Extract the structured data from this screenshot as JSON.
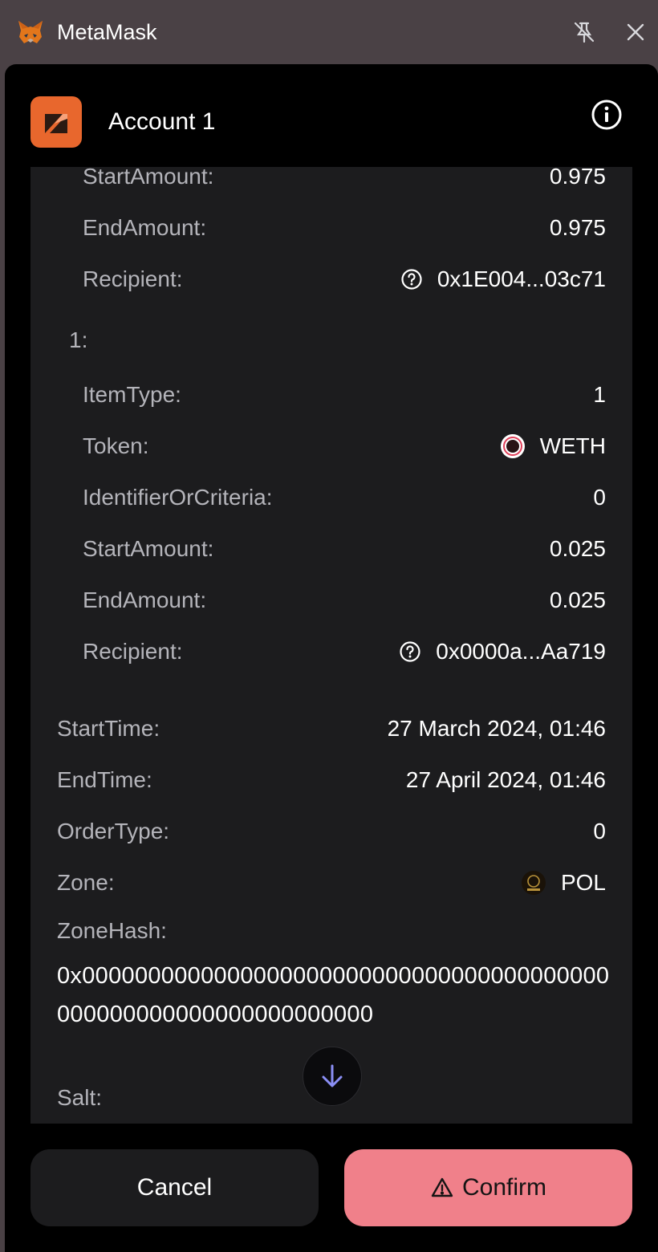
{
  "window": {
    "title": "MetaMask",
    "logo_icon": "metamask-fox-icon",
    "pin_icon": "unpin-icon",
    "close_icon": "close-icon"
  },
  "header": {
    "account_name": "Account 1",
    "avatar_icon": "account-avatar-icon",
    "avatar_color": "#e8672d",
    "info_icon": "info-icon"
  },
  "consideration": {
    "item0_partial": {
      "start_amount_label": "StartAmount:",
      "start_amount": "0.975",
      "end_amount_label": "EndAmount:",
      "end_amount": "0.975",
      "recipient_label": "Recipient:",
      "recipient": "0x1E004...03c71"
    },
    "item1": {
      "index": "1:",
      "item_type_label": "ItemType:",
      "item_type": "1",
      "token_label": "Token:",
      "token": "WETH",
      "identifier_label": "IdentifierOrCriteria:",
      "identifier": "0",
      "start_amount_label": "StartAmount:",
      "start_amount": "0.025",
      "end_amount_label": "EndAmount:",
      "end_amount": "0.025",
      "recipient_label": "Recipient:",
      "recipient": "0x0000a...Aa719"
    }
  },
  "order": {
    "start_time_label": "StartTime:",
    "start_time": "27 March 2024, 01:46",
    "end_time_label": "EndTime:",
    "end_time": "27 April 2024, 01:46",
    "order_type_label": "OrderType:",
    "order_type": "0",
    "zone_label": "Zone:",
    "zone": "POL",
    "zone_hash_label": "ZoneHash:",
    "zone_hash": "0x0000000000000000000000000000000000000000000000000000000000000000",
    "salt_label": "Salt:"
  },
  "footer": {
    "cancel_label": "Cancel",
    "confirm_label": "Confirm",
    "confirm_color": "#f0808a",
    "warning_icon": "warning-icon",
    "scroll_icon": "arrow-down-icon"
  }
}
